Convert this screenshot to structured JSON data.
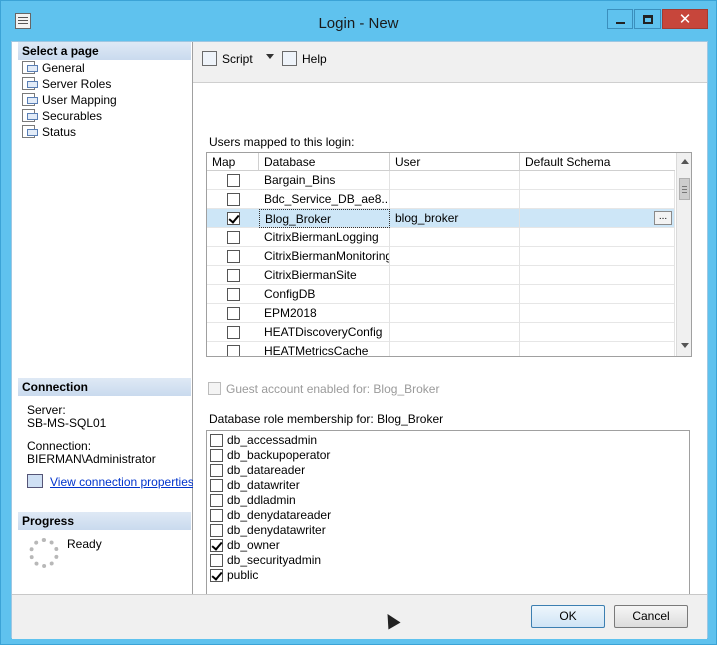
{
  "window": {
    "title": "Login - New",
    "controls": {
      "minimize": "minimize",
      "maximize": "maximize",
      "close": "✕"
    }
  },
  "left_pane": {
    "select_page_header": "Select a page",
    "pages": [
      "General",
      "Server Roles",
      "User Mapping",
      "Securables",
      "Status"
    ],
    "connection_header": "Connection",
    "server_label": "Server:",
    "server_value": "SB-MS-SQL01",
    "connection_label": "Connection:",
    "connection_value": "BIERMAN\\Administrator",
    "view_properties_link": "View connection properties",
    "progress_header": "Progress",
    "progress_status": "Ready"
  },
  "toolbar": {
    "script_label": "Script",
    "help_label": "Help"
  },
  "user_mapping": {
    "grid_label": "Users mapped to this login:",
    "columns": [
      "Map",
      "Database",
      "User",
      "Default Schema"
    ],
    "rows": [
      {
        "map": false,
        "database": "Bargain_Bins",
        "user": "",
        "schema": ""
      },
      {
        "map": false,
        "database": "Bdc_Service_DB_ae8...",
        "user": "",
        "schema": ""
      },
      {
        "map": true,
        "database": "Blog_Broker",
        "user": "blog_broker",
        "schema": "",
        "selected": true,
        "browse": "..."
      },
      {
        "map": false,
        "database": "CitrixBiermanLogging",
        "user": "",
        "schema": ""
      },
      {
        "map": false,
        "database": "CitrixBiermanMonitoring",
        "user": "",
        "schema": ""
      },
      {
        "map": false,
        "database": "CitrixBiermanSite",
        "user": "",
        "schema": ""
      },
      {
        "map": false,
        "database": "ConfigDB",
        "user": "",
        "schema": ""
      },
      {
        "map": false,
        "database": "EPM2018",
        "user": "",
        "schema": ""
      },
      {
        "map": false,
        "database": "HEATDiscoveryConfig",
        "user": "",
        "schema": ""
      },
      {
        "map": false,
        "database": "HEATMetricsCache",
        "user": "",
        "schema": ""
      }
    ],
    "guest_label": "Guest account enabled for: Blog_Broker",
    "roles_label": "Database role membership for: Blog_Broker",
    "roles": [
      {
        "name": "db_accessadmin",
        "checked": false
      },
      {
        "name": "db_backupoperator",
        "checked": false
      },
      {
        "name": "db_datareader",
        "checked": false
      },
      {
        "name": "db_datawriter",
        "checked": false
      },
      {
        "name": "db_ddladmin",
        "checked": false
      },
      {
        "name": "db_denydatareader",
        "checked": false
      },
      {
        "name": "db_denydatawriter",
        "checked": false
      },
      {
        "name": "db_owner",
        "checked": true
      },
      {
        "name": "db_securityadmin",
        "checked": false
      },
      {
        "name": "public",
        "checked": true
      }
    ]
  },
  "footer": {
    "ok_label": "OK",
    "cancel_label": "Cancel"
  },
  "colors": {
    "title_bar": "#5fc2ee",
    "close_button": "#c7463b",
    "selected_row": "#cde6f7",
    "link": "#0033cc"
  }
}
